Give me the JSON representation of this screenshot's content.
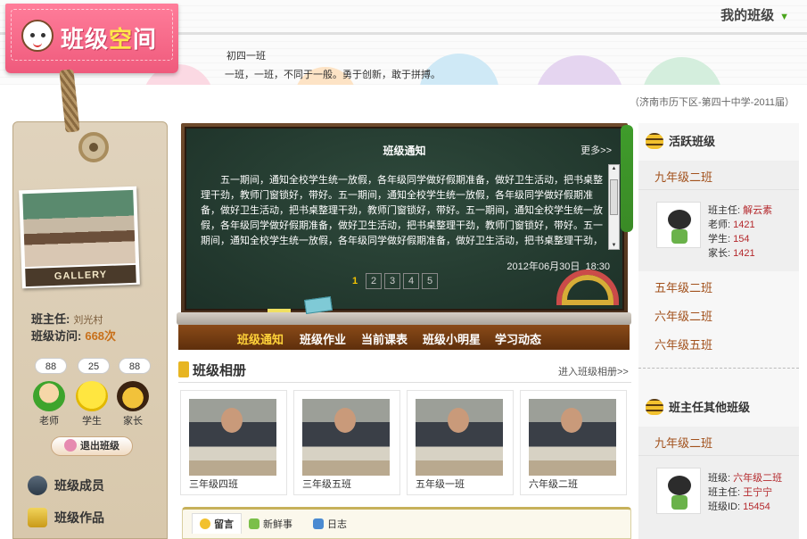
{
  "header": {
    "logo_text_1": "班级",
    "logo_text_2": "空",
    "logo_text_3": "间",
    "class_name": "初四一班",
    "motto": "一班，一班，不同于一般。勇于创新，敢于拼搏。",
    "my_class_label": "我的班级",
    "location": "（济南市历下区-第四十中学-2011届）"
  },
  "left": {
    "gallery_label": "GALLERY",
    "teacher_label": "班主任:",
    "teacher_name": "刘光村",
    "visits_label": "班级访问:",
    "visits_value": "668次",
    "stats": [
      {
        "count": "88",
        "label": "老师"
      },
      {
        "count": "25",
        "label": "学生"
      },
      {
        "count": "88",
        "label": "家长"
      }
    ],
    "leave_button": "退出班级",
    "menu": [
      {
        "label": "班级成员"
      },
      {
        "label": "班级作品"
      }
    ]
  },
  "board": {
    "title": "班级通知",
    "more": "更多>>",
    "text": "五一期间，通知全校学生统一放假，各年级同学做好假期准备，做好卫生活动，把书桌整理干劲，教师门窗锁好，带好。五一期间，通知全校学生统一放假，各年级同学做好假期准备，做好卫生活动，把书桌整理干劲，教师门窗锁好，带好。五一期间，通知全校学生统一放假，各年级同学做好假期准备，做好卫生活动，把书桌整理干劲，教师门窗锁好，带好。五一期间，通知全校学生统一放假，各年级同学做好假期准备，做好卫生活动，把书桌整理干劲，教师门窗锁好，带好。",
    "date": "2012年06月30日",
    "time": "18:30",
    "pages": [
      "1",
      "2",
      "3",
      "4",
      "5"
    ],
    "nav": [
      "班级通知",
      "班级作业",
      "当前课表",
      "班级小明星",
      "学习动态"
    ]
  },
  "album": {
    "title": "班级相册",
    "more": "进入班级相册>>",
    "items": [
      {
        "caption": "三年级四班"
      },
      {
        "caption": "三年级五班"
      },
      {
        "caption": "五年级一班"
      },
      {
        "caption": "六年级二班"
      }
    ]
  },
  "tabs": [
    "留言",
    "新鲜事",
    "日志"
  ],
  "right": {
    "active_title": "活跃班级",
    "active_top": {
      "name": "九年级二班",
      "teacher_label": "班主任:",
      "teacher": "解云素",
      "teachers_label": "老师:",
      "teachers": "1421",
      "students_label": "学生:",
      "students": "154",
      "parents_label": "家长:",
      "parents": "1421"
    },
    "active_list": [
      "五年级二班",
      "六年级二班",
      "六年级五班"
    ],
    "other_title": "班主任其他班级",
    "other_top": {
      "name": "九年级二班",
      "class_label": "班级:",
      "class": "六年级二班",
      "teacher_label": "班主任:",
      "teacher": "王宁宁",
      "id_label": "班级ID:",
      "id": "15454"
    }
  },
  "colors": {
    "logo_pink": "#ef5a7c",
    "board_green": "#1d3128",
    "nav_brown": "#5e2f0c",
    "accent_orange": "#c8701a",
    "link_red": "#b4282c"
  }
}
